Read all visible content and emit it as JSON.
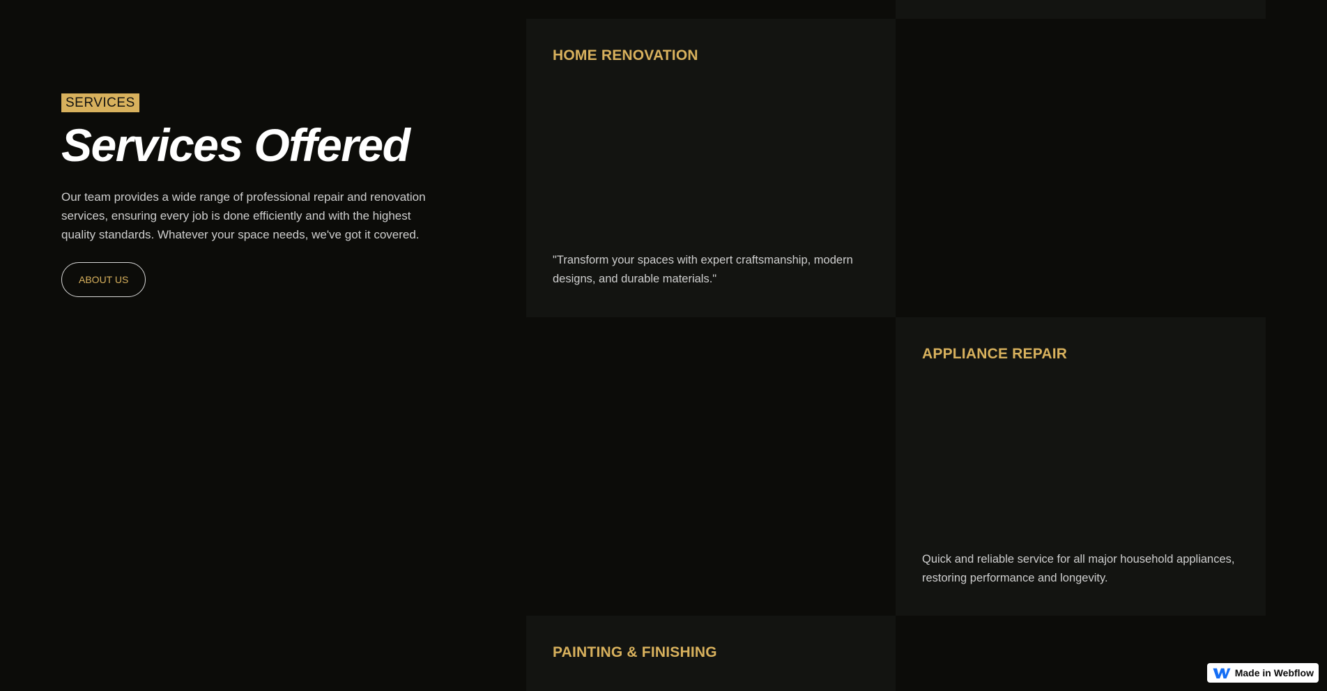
{
  "intro": {
    "tag": "SERVICES",
    "heading": "Services Offered",
    "description": "Our team provides a wide range of professional repair and renovation services, ensuring every job is done efficiently and with the highest quality standards. Whatever your space needs, we've got it covered.",
    "button_label": "ABOUT US"
  },
  "services": [
    {
      "title": "HOME RENOVATION",
      "description": "\"Transform your spaces with expert craftsmanship, modern designs, and durable materials.\""
    },
    {
      "title": "APPLIANCE REPAIR",
      "description": "Quick and reliable service for all major household appliances, restoring performance and longevity."
    },
    {
      "title": "PAINTING & FINISHING",
      "description": ""
    }
  ],
  "badge": {
    "label": "Made in Webflow",
    "icon": "webflow-logo-icon"
  },
  "colors": {
    "background": "#0c0c09",
    "card": "#131411",
    "accent": "#d8b15d",
    "text": "#cfcfcf",
    "heading": "#ffffff"
  }
}
